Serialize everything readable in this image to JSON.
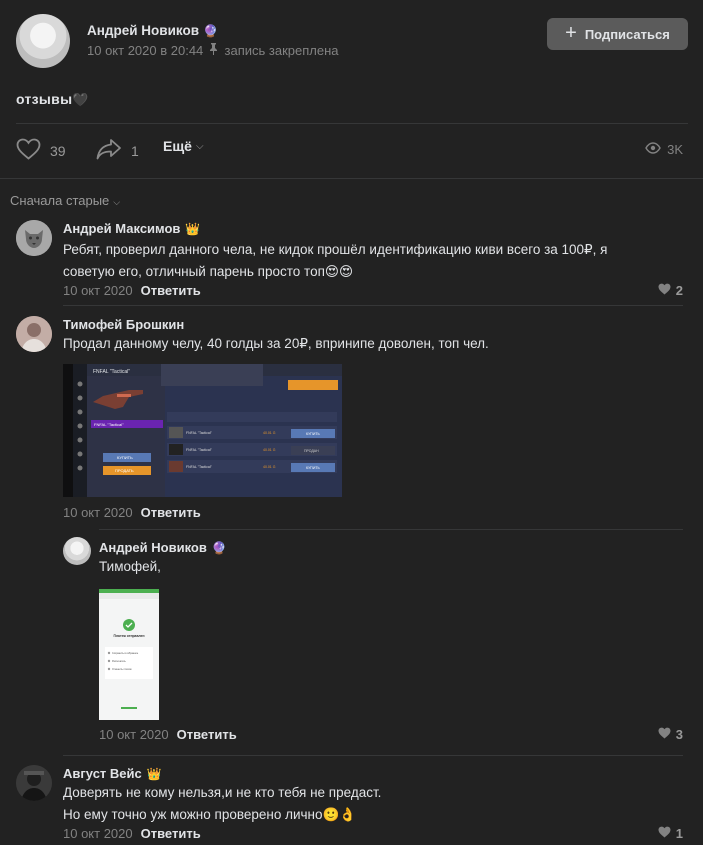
{
  "post": {
    "author": "Андрей Новиков",
    "author_badge": "🔮",
    "date": "10 окт 2020 в 20:44",
    "pinned": "запись закреплена",
    "subscribe_label": "Подписаться",
    "text": "отзывы",
    "text_emoji": "🖤",
    "likes": "39",
    "shares": "1",
    "more_label": "Ещё",
    "views": "3K"
  },
  "sort_label": "Сначала старые",
  "comments": [
    {
      "author": "Андрей Максимов",
      "badge": "👑",
      "text_line1": "Ребят, проверил данного чела, не кидок прошёл идентификацию киви всего за 100₽, я",
      "text_line2": "советую его, отличный парень просто топ😍😍",
      "date": "10 окт 2020",
      "reply_label": "Ответить",
      "likes": "2"
    },
    {
      "author": "Тимофей Брошкин",
      "text": "Продал данному челу, 40 голды за 20₽, впринипе доволен, топ чел.",
      "date": "10 окт 2020",
      "reply_label": "Ответить",
      "image_texts": {
        "title": "FNFAL \"Tactical\"",
        "selected": "FNFAL \"Tactical\"",
        "sell_button": "КУПИТЬ",
        "buy_button": "ПРОДАТЬ",
        "rows": [
          {
            "name": "FNFAL \"Tactical\"",
            "price": "40.01 G",
            "action": "КУПИТЬ"
          },
          {
            "name": "FNFAL \"Tactical\"",
            "price": "40.01 G",
            "action": "ПРОДАН"
          },
          {
            "name": "FNFAL \"Tactical\"",
            "price": "40.01 G",
            "action": "КУПИТЬ"
          }
        ]
      }
    },
    {
      "author": "Андрей Новиков",
      "badge": "🔮",
      "text": "Тимофей,",
      "date": "10 окт 2020",
      "reply_label": "Ответить",
      "likes": "3",
      "image_texts": {
        "title": "Платеж отправлен",
        "items": [
          "Сохранить в избранное",
          "Распечатать",
          "Отменить платёж"
        ]
      }
    },
    {
      "author": "Август Вейс",
      "badge": "👑",
      "text_line1": "Доверять не кому нельзя,и не кто тебя не предаст.",
      "text_line2": "Но ему точно уж можно проверено лично🙂👌",
      "date": "10 окт 2020",
      "reply_label": "Ответить",
      "likes": "1"
    }
  ]
}
